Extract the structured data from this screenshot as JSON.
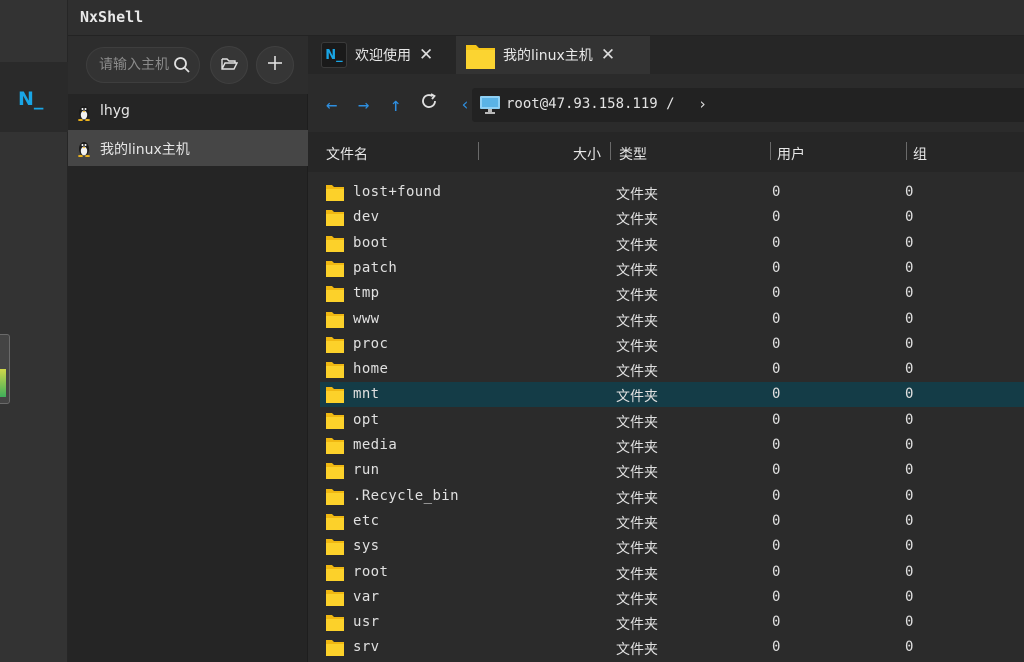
{
  "app": {
    "title": "NxShell",
    "logo_text": "N_"
  },
  "hosts": {
    "search_placeholder": "请输入主机",
    "items": [
      {
        "label": "lhyg",
        "active": false
      },
      {
        "label": "我的linux主机",
        "active": true
      }
    ]
  },
  "tabs": [
    {
      "icon": "N_",
      "label": "欢迎使用",
      "close": "✕"
    },
    {
      "icon": "folder-icon",
      "label": "我的linux主机",
      "close": "✕"
    }
  ],
  "path": {
    "text": "root@47.93.158.119 /"
  },
  "columns": {
    "name": "文件名",
    "size": "大小",
    "type": "类型",
    "user": "用户",
    "group": "组"
  },
  "files": [
    {
      "name": "lost+found",
      "type": "文件夹",
      "user": "0",
      "group": "0"
    },
    {
      "name": "dev",
      "type": "文件夹",
      "user": "0",
      "group": "0"
    },
    {
      "name": "boot",
      "type": "文件夹",
      "user": "0",
      "group": "0"
    },
    {
      "name": "patch",
      "type": "文件夹",
      "user": "0",
      "group": "0"
    },
    {
      "name": "tmp",
      "type": "文件夹",
      "user": "0",
      "group": "0"
    },
    {
      "name": "www",
      "type": "文件夹",
      "user": "0",
      "group": "0"
    },
    {
      "name": "proc",
      "type": "文件夹",
      "user": "0",
      "group": "0"
    },
    {
      "name": "home",
      "type": "文件夹",
      "user": "0",
      "group": "0"
    },
    {
      "name": "mnt",
      "type": "文件夹",
      "user": "0",
      "group": "0",
      "selected": true
    },
    {
      "name": "opt",
      "type": "文件夹",
      "user": "0",
      "group": "0"
    },
    {
      "name": "media",
      "type": "文件夹",
      "user": "0",
      "group": "0"
    },
    {
      "name": "run",
      "type": "文件夹",
      "user": "0",
      "group": "0"
    },
    {
      "name": ".Recycle_bin",
      "type": "文件夹",
      "user": "0",
      "group": "0"
    },
    {
      "name": "etc",
      "type": "文件夹",
      "user": "0",
      "group": "0"
    },
    {
      "name": "sys",
      "type": "文件夹",
      "user": "0",
      "group": "0"
    },
    {
      "name": "root",
      "type": "文件夹",
      "user": "0",
      "group": "0"
    },
    {
      "name": "var",
      "type": "文件夹",
      "user": "0",
      "group": "0"
    },
    {
      "name": "usr",
      "type": "文件夹",
      "user": "0",
      "group": "0"
    },
    {
      "name": "srv",
      "type": "文件夹",
      "user": "0",
      "group": "0"
    }
  ],
  "colors": {
    "accent": "#2e8fe0",
    "logo": "#19a6e6",
    "folder": "#f5c518",
    "selected_row": "#143c47"
  }
}
